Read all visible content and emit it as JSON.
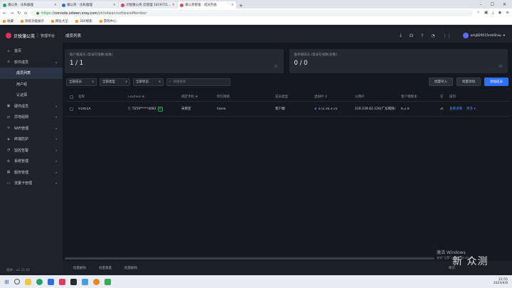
{
  "browser": {
    "tabs": [
      {
        "title": "蒲公英 - 乐私服理",
        "active": false,
        "fav": "green"
      },
      {
        "title": "蒲公英 - 乐私服理",
        "active": false,
        "fav": "blue"
      },
      {
        "title": "贝锐蒲公英-云管理 1829751...",
        "active": false,
        "fav": "pink"
      },
      {
        "title": "蒲公英管理 - 成员列表",
        "active": true,
        "fav": "pink"
      }
    ],
    "new_tab": "+",
    "url_prefix": "https://",
    "url_host": "console.sdwan.oray.com",
    "url_path": "/zh/sdwan/softwareMember",
    "bookmarks": [
      "收藏",
      "系统功能展示",
      "网址大全",
      "360搜索",
      "游戏中心"
    ]
  },
  "app": {
    "brand": "贝锐蒲公英",
    "brand_sub": "管理平台",
    "page_title": "成员列表",
    "user_name": "orkj829515mh0rau"
  },
  "sidebar": {
    "items": [
      {
        "label": "首页",
        "icon": "home-icon",
        "sub": false,
        "chev": false
      },
      {
        "label": "软件成员",
        "icon": "user-icon",
        "sub": false,
        "chev": true
      },
      {
        "label": "成员列表",
        "icon": "",
        "sub": true,
        "chev": false,
        "selected": true
      },
      {
        "label": "用户组",
        "icon": "",
        "sub": true,
        "chev": false
      },
      {
        "label": "认证源",
        "icon": "",
        "sub": true,
        "chev": false
      },
      {
        "label": "硬件成员",
        "icon": "device-icon",
        "sub": false,
        "chev": true
      },
      {
        "label": "异地组网",
        "icon": "network-icon",
        "sub": false,
        "chev": true
      },
      {
        "label": "WiFi管理",
        "icon": "wifi-icon",
        "sub": false,
        "chev": true
      },
      {
        "label": "终端防护",
        "icon": "shield-icon",
        "sub": false,
        "chev": true
      },
      {
        "label": "监控告警",
        "icon": "bell-icon",
        "sub": false,
        "chev": true
      },
      {
        "label": "系统管理",
        "icon": "gear-icon",
        "sub": false,
        "chev": true
      },
      {
        "label": "服务管理",
        "icon": "service-icon",
        "sub": false,
        "chev": true
      },
      {
        "label": "流量卡管理",
        "icon": "card-icon",
        "sub": false,
        "chev": true
      }
    ],
    "version": "版本：v2.11.61"
  },
  "cards": [
    {
      "label": "账户端成员 (登录在线数/总数)",
      "value": "1 / 1"
    },
    {
      "label": "服务端成员 (登录在线数/总数)",
      "value": "0 / 0"
    }
  ],
  "filters": {
    "members": "全部成员",
    "types": "全部类型",
    "status": "全部状态",
    "search_placeholder": "快捷搜索",
    "btn_import": "批量导入",
    "btn_batch_add": "批量添加",
    "btn_add": "添加成员"
  },
  "table": {
    "headers": [
      "名称",
      "LED/SID ⊕",
      "绑定手机 ⊕",
      "所在网络",
      "成员类型",
      "虚拟IP ⇕",
      "公网IP",
      "客户端版本",
      "在",
      "操作"
    ],
    "rows": [
      {
        "name": "V1955A",
        "sid": "7259*****4081",
        "sid_tag": "在",
        "phone": "未绑定",
        "network": "hanlx",
        "type": "客户端",
        "vip": "172.16.3.21",
        "pip": "120.239.62.126(广东揭阳)",
        "version": "6.2.0",
        "online": "2(",
        "op_detail": "查看详情",
        "op_more": "更多 ▾"
      }
    ]
  },
  "footer": {
    "actions": [
      "批量删除",
      "批量重置",
      "批量删除"
    ],
    "page_label": "每页"
  },
  "overlay": {
    "activate_title": "激活 Windows",
    "activate_sub": "转到“设置”以激活 Windows。",
    "watermark": "新 众测"
  },
  "taskbar": {
    "time": "22:55",
    "date": "2024/4/8"
  }
}
